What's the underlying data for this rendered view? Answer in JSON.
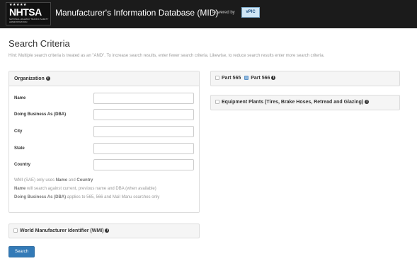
{
  "header": {
    "logo_stars": "★★★★★",
    "logo_text": "NHTSA",
    "logo_subtext": "NATIONAL HIGHWAY TRAFFIC SAFETY ADMINISTRATION",
    "title": "Manufacturer's Information Database (MID)",
    "powered_by": "Powered by",
    "vpic_label": "vPIC"
  },
  "page": {
    "title": "Search Criteria",
    "hint": "Hint: Multiple search criteria is treated as an \"AND\". To increase search results, enter fewer search criteria. Likewise, to reduce search results enter more search criteria."
  },
  "organization": {
    "heading": "Organization",
    "fields": [
      {
        "label": "Name",
        "value": ""
      },
      {
        "label": "Doing Business As (DBA)",
        "value": ""
      },
      {
        "label": "City",
        "value": ""
      },
      {
        "label": "State",
        "value": ""
      },
      {
        "label": "Country",
        "value": ""
      }
    ],
    "notes": [
      {
        "prefix": "WMI (SAE) only uses ",
        "bold1": "Name",
        "mid": " and ",
        "bold2": "Country",
        "suffix": ""
      },
      {
        "prefix": "",
        "bold1": "Name",
        "mid": " will search against current, previous name and DBA (when available)",
        "bold2": "",
        "suffix": ""
      },
      {
        "prefix": "",
        "bold1": "Doing Business As (DBA)",
        "mid": " applies to 565, 566 and Mail Manu searches only",
        "bold2": "",
        "suffix": ""
      }
    ]
  },
  "wmi": {
    "label": "World Manufacturer Identifier (WMI)",
    "checked": false
  },
  "part565": {
    "label": "Part 565",
    "checked": false
  },
  "part566": {
    "label": "Part 566",
    "checked": true
  },
  "plants": {
    "label": "Equipment Plants (Tires, Brake Hoses, Retread and Glazing)",
    "checked": false
  },
  "actions": {
    "search_label": "Search"
  }
}
